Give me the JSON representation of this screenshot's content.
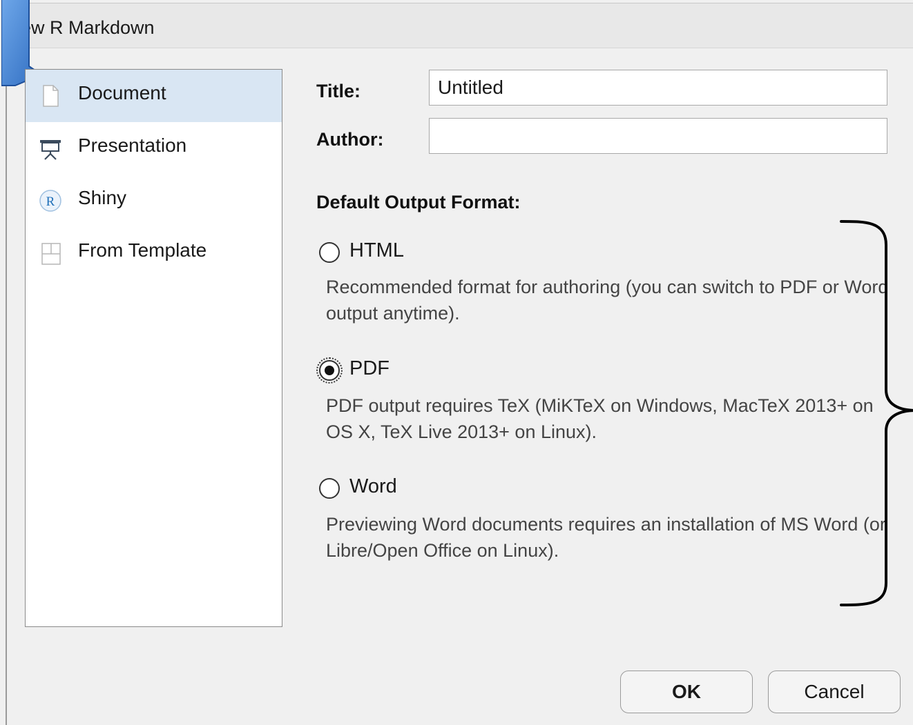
{
  "window": {
    "title": "ew R Markdown"
  },
  "sidebar": {
    "items": [
      {
        "label": "Document",
        "icon": "document-icon",
        "selected": true
      },
      {
        "label": "Presentation",
        "icon": "presentation-icon",
        "selected": false
      },
      {
        "label": "Shiny",
        "icon": "r-shiny-icon",
        "selected": false
      },
      {
        "label": "From Template",
        "icon": "template-icon",
        "selected": false
      }
    ]
  },
  "form": {
    "title_label": "Title:",
    "title_value": "Untitled",
    "author_label": "Author:",
    "author_value": ""
  },
  "output": {
    "heading": "Default Output Format:",
    "options": [
      {
        "label": "HTML",
        "description": "Recommended format for authoring (you can switch to PDF or Word output anytime).",
        "checked": false
      },
      {
        "label": "PDF",
        "description": "PDF output requires TeX (MiKTeX on Windows, MacTeX 2013+ on OS X, TeX Live 2013+ on Linux).",
        "checked": true
      },
      {
        "label": "Word",
        "description": "Previewing Word documents requires an installation of MS Word (or Libre/Open Office on Linux).",
        "checked": false
      }
    ]
  },
  "buttons": {
    "ok": "OK",
    "cancel": "Cancel"
  },
  "colors": {
    "selected_bg": "#d9e6f3",
    "accent_blue": "#3f7fd1"
  }
}
